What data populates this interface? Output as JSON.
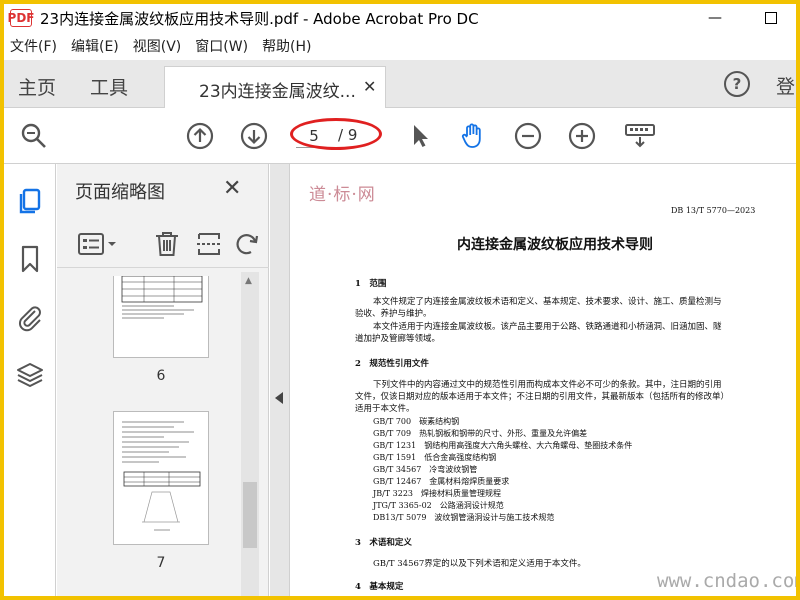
{
  "window": {
    "title": "23内连接金属波纹板应用技术导则.pdf - Adobe Acrobat Pro DC",
    "logo_text": "PDF",
    "minimize": "—"
  },
  "menu": [
    "文件(F)",
    "编辑(E)",
    "视图(V)",
    "窗口(W)",
    "帮助(H)"
  ],
  "tabs": {
    "home": "主页",
    "tools": "工具",
    "doc_tab": "23内连接金属波纹...",
    "doc_close": "✕",
    "help": "?",
    "login": "登"
  },
  "toolbar": {
    "current_page": "5",
    "total_pages": "/ 9"
  },
  "thumb_panel": {
    "title": "页面缩略图",
    "close": "✕",
    "thumbs": [
      {
        "label": "6"
      },
      {
        "label": "7"
      }
    ]
  },
  "document": {
    "code": "DB 13/T 5770—2023",
    "title": "内连接金属波纹板应用技术导则",
    "s1_heading": "1　范围",
    "s1_p1a": "本文件规定了内连接金属波纹板术语和定义、基本规定、技术要求、设计、施工、质量检测与",
    "s1_p1b": "验收、养护与维护。",
    "s1_p2a": "本文件适用于内连接金属波纹板。该产品主要用于公路、铁路通道和小桥涵洞、旧涵加固、隧",
    "s1_p2b": "道加护及管廊等领域。",
    "s2_heading": "2　规范性引用文件",
    "s2_p1a": "下列文件中的内容通过文中的规范性引用而构成本文件必不可少的条款。其中，注日期的引用",
    "s2_p1b": "文件，仅该日期对应的版本适用于本文件；不注日期的引用文件，其最新版本（包括所有的修改单）",
    "s2_p1c": "适用于本文件。",
    "refs": [
      "GB/T 700　碳素结构钢",
      "GB/T 709　热轧钢板和钢带的尺寸、外形、重量及允许偏差",
      "GB/T 1231　钢结构用高强度大六角头螺栓、大六角螺母、垫圈技术条件",
      "GB/T 1591　低合金高强度结构钢",
      "GB/T 34567　冷弯波纹钢管",
      "GB/T 12467　金属材料熔焊质量要求",
      "JB/T 3223　焊接材料质量管理规程",
      "JTG/T 3365-02　公路涵洞设计规范",
      "DB13/T 5079　波纹钢管涵洞设计与施工技术规范"
    ],
    "s3_heading": "3　术语和定义",
    "s3_p1": "GB/T 34567界定的以及下列术语和定义适用于本文件。",
    "s4_heading": "4　基本规定"
  },
  "watermarks": {
    "bottom_right": "www.cndao.com",
    "top_left": "道·标·网"
  },
  "colors": {
    "accent_blue": "#1473e6",
    "annotation_red": "#e02020",
    "frame_yellow": "#f2c200"
  }
}
